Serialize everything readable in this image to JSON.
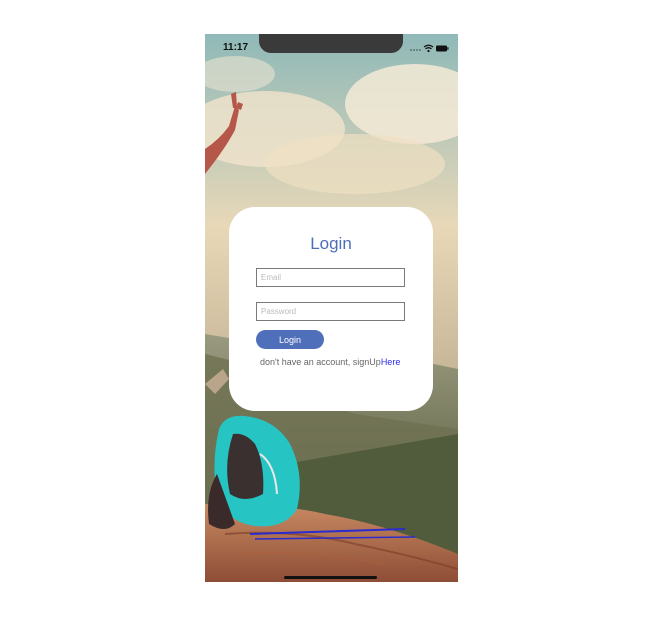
{
  "status_bar": {
    "time": "11:17"
  },
  "login_card": {
    "title": "Login",
    "email_placeholder": "Email",
    "email_value": "",
    "password_placeholder": "Password",
    "password_value": "",
    "login_button_label": "Login",
    "signup_prompt": "don't have an account, signUp",
    "signup_link_label": "Here"
  },
  "colors": {
    "accent": "#4f6fba",
    "title": "#4e6fb8",
    "link": "#2d2df0"
  },
  "icons": [
    "wifi-icon",
    "battery-icon",
    "signal-icon"
  ]
}
